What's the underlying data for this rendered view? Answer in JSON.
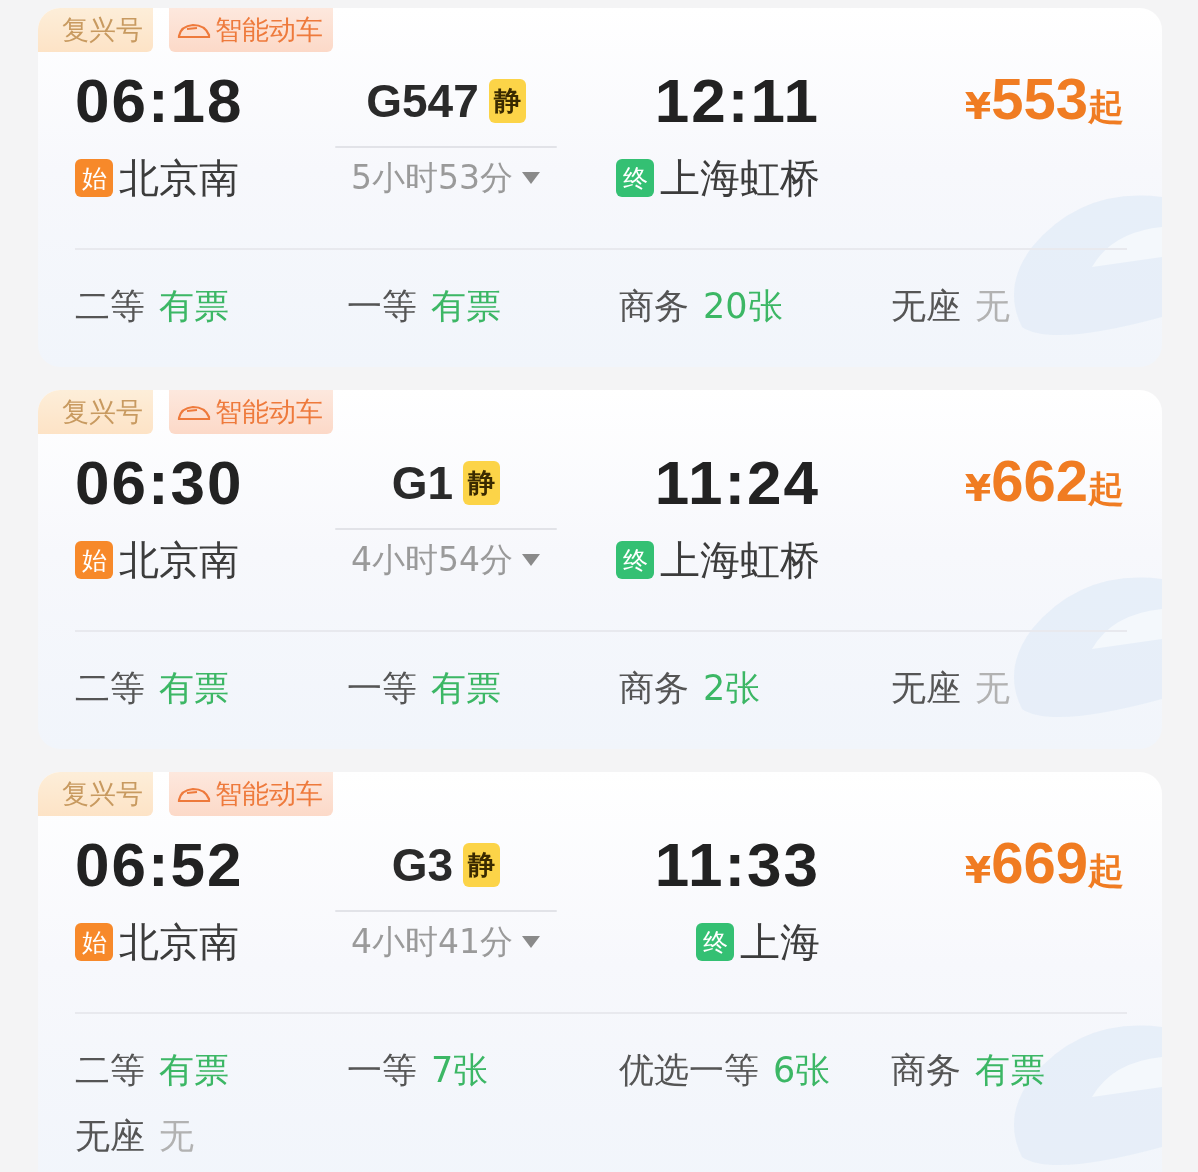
{
  "trains": [
    {
      "tags": [
        {
          "kind": "brand",
          "label": "复兴号"
        },
        {
          "kind": "smart",
          "label": "智能动车"
        }
      ],
      "depart_time": "06:18",
      "depart_badge": "始",
      "depart_station": "北京南",
      "train_no": "G547",
      "quiet_badge": "静",
      "duration": "5小时53分",
      "arrive_time": "12:11",
      "arrive_badge": "终",
      "arrive_station": "上海虹桥",
      "price_symbol": "¥",
      "price": "553",
      "price_suffix": "起",
      "seats": [
        {
          "name": "二等",
          "status": "有票",
          "available": true
        },
        {
          "name": "一等",
          "status": "有票",
          "available": true
        },
        {
          "name": "商务",
          "status": "20张",
          "available": true
        },
        {
          "name": "无座",
          "status": "无",
          "available": false
        }
      ]
    },
    {
      "tags": [
        {
          "kind": "brand",
          "label": "复兴号"
        },
        {
          "kind": "smart",
          "label": "智能动车"
        }
      ],
      "depart_time": "06:30",
      "depart_badge": "始",
      "depart_station": "北京南",
      "train_no": "G1",
      "quiet_badge": "静",
      "duration": "4小时54分",
      "arrive_time": "11:24",
      "arrive_badge": "终",
      "arrive_station": "上海虹桥",
      "price_symbol": "¥",
      "price": "662",
      "price_suffix": "起",
      "seats": [
        {
          "name": "二等",
          "status": "有票",
          "available": true
        },
        {
          "name": "一等",
          "status": "有票",
          "available": true
        },
        {
          "name": "商务",
          "status": "2张",
          "available": true
        },
        {
          "name": "无座",
          "status": "无",
          "available": false
        }
      ]
    },
    {
      "tags": [
        {
          "kind": "brand",
          "label": "复兴号"
        },
        {
          "kind": "smart",
          "label": "智能动车"
        }
      ],
      "depart_time": "06:52",
      "depart_badge": "始",
      "depart_station": "北京南",
      "train_no": "G3",
      "quiet_badge": "静",
      "duration": "4小时41分",
      "arrive_time": "11:33",
      "arrive_badge": "终",
      "arrive_station": "上海",
      "price_symbol": "¥",
      "price": "669",
      "price_suffix": "起",
      "seats": [
        {
          "name": "二等",
          "status": "有票",
          "available": true
        },
        {
          "name": "一等",
          "status": "7张",
          "available": true
        },
        {
          "name": "优选一等",
          "status": "6张",
          "available": true
        },
        {
          "name": "商务",
          "status": "有票",
          "available": true
        },
        {
          "name": "无座",
          "status": "无",
          "available": false
        }
      ]
    }
  ]
}
